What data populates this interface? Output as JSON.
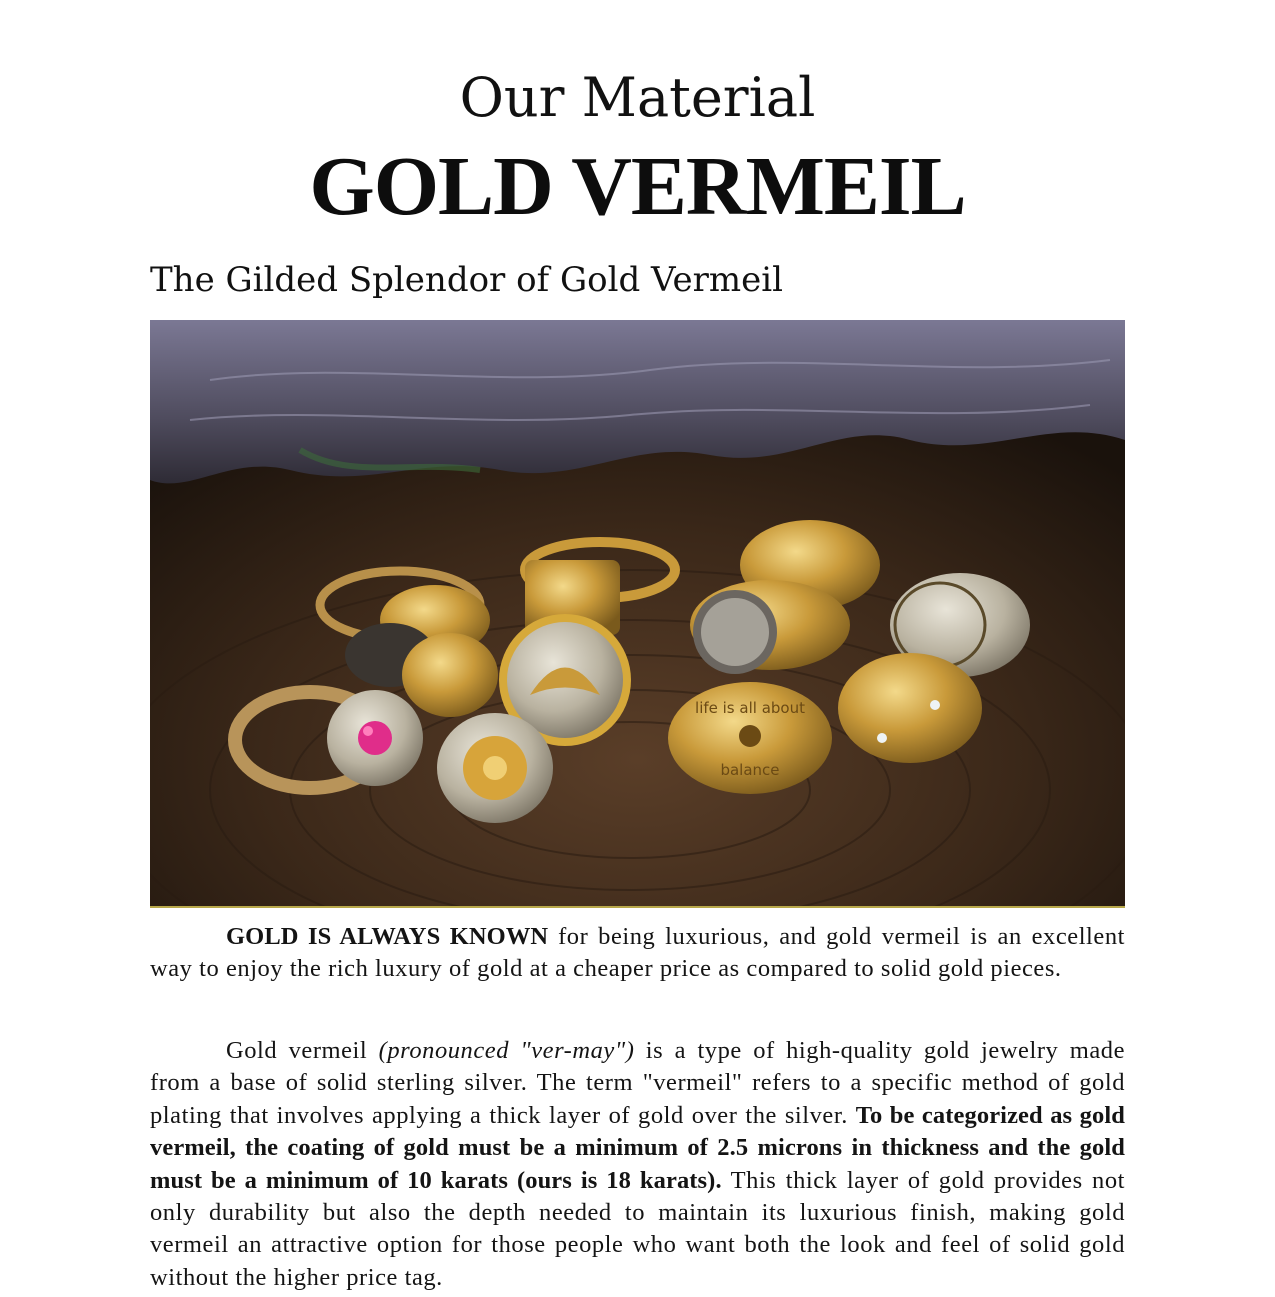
{
  "header": {
    "eyebrow": "Our Material",
    "title": "GOLD VERMEIL",
    "subtitle": "The Gilded Splendor of Gold Vermeil"
  },
  "photo": {
    "ring_inscription_top": "life is all about",
    "ring_inscription_bottom": "balance",
    "colors": {
      "wood_dark": "#2a1d14",
      "wood_mid": "#4a3322",
      "leaf": "#5a5a6e",
      "gold": "#c99a3a",
      "gold_light": "#e8c56a",
      "ruby": "#e02d8a"
    }
  },
  "body": {
    "p1_lead": "GOLD IS ALWAYS KNOWN",
    "p1_text": " for being luxurious, and gold vermeil is an excellent way to enjoy the rich luxury of gold at a cheaper price as compared to solid gold pieces.",
    "p2_start": "Gold vermeil ",
    "p2_pronounce": "(pronounced \"ver-may\")",
    "p2_mid": " is a type of high-quality gold jewelry made from a base of solid sterling silver. The term \"vermeil\" refers to a specific method of gold plating that involves applying a thick layer of gold over the silver. ",
    "p2_bold": "To be categorized as gold vermeil, the coating of gold must be a minimum of 2.5 microns in thickness and the gold must be a minimum of 10 karats (ours is 18 karats).",
    "p2_end": " This thick layer of gold provides not only durability but also the depth needed to maintain its luxurious finish, making gold vermeil an attractive option for those people who want both the look and feel of solid gold without the higher price tag."
  }
}
